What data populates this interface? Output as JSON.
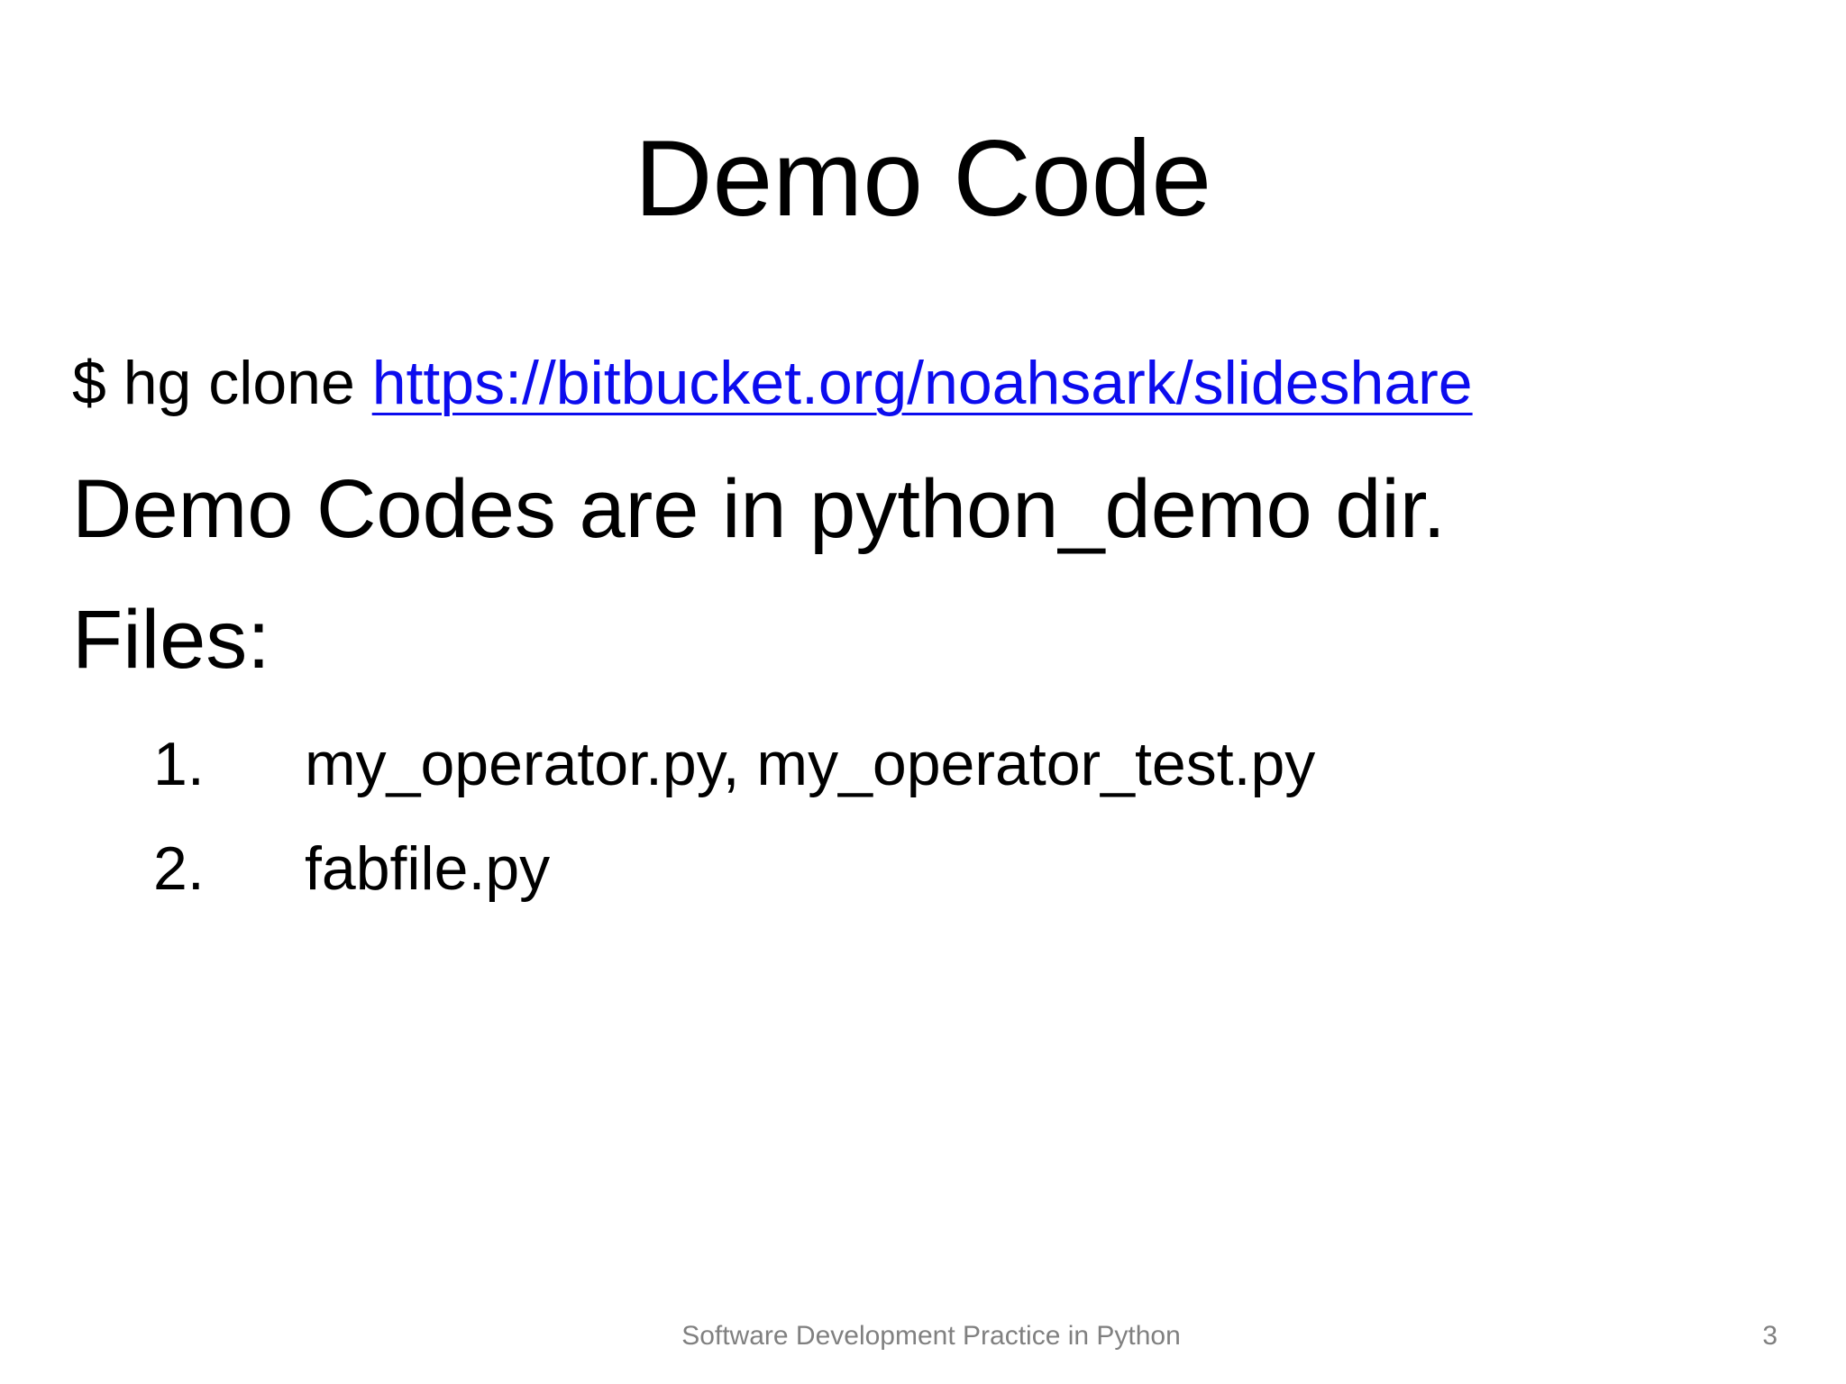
{
  "slide": {
    "title": "Demo Code",
    "clone_prefix": "$ hg clone ",
    "clone_url": "https://bitbucket.org/noahsark/slideshare",
    "demo_line": "Demo Codes are in python_demo dir.",
    "files_label": "Files:",
    "files": [
      {
        "number": "1.",
        "text": "my_operator.py, my_operator_test.py"
      },
      {
        "number": "2.",
        "text": "fabfile.py"
      }
    ],
    "footer": "Software Development Practice in Python",
    "page_number": "3"
  },
  "colors": {
    "link": "#0c0cee",
    "text": "#000000",
    "footer": "#808080",
    "background": "#ffffff"
  }
}
